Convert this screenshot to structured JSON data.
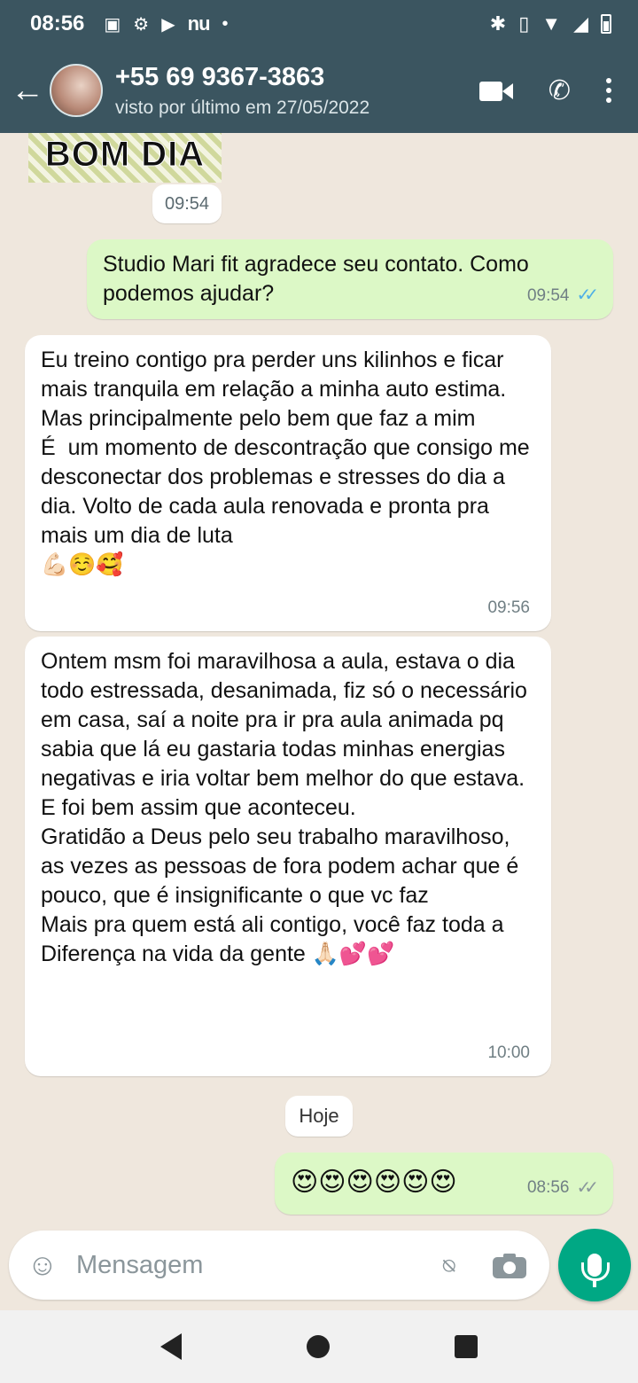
{
  "status_bar": {
    "time": "08:56",
    "icons": [
      "image-icon",
      "gear-icon",
      "youtube-icon",
      "nubank-icon",
      "dot-icon"
    ],
    "nu_label": "nu",
    "right_icons": [
      "bluetooth-icon",
      "vibrate-icon",
      "wifi-icon",
      "signal-icon",
      "battery-icon"
    ]
  },
  "header": {
    "title": "+55 69 9367-3863",
    "subtitle": "visto por último em 27/05/2022",
    "actions": [
      "video-call-icon",
      "phone-icon",
      "more-vert-icon"
    ]
  },
  "messages": {
    "sticker": {
      "text": "BOM DIA",
      "time": "09:54"
    },
    "m1": {
      "text": "Studio Mari fit agradece seu contato. Como podemos ajudar?",
      "time": "09:54",
      "status": "read"
    },
    "m2": {
      "text": "Eu treino contigo pra perder uns kilinhos e ficar mais tranquila em relação a minha auto estima.\nMas principalmente pelo bem que faz a mim\nÉ  um momento de descontração que consigo me desconectar dos problemas e stresses do dia a dia. Volto de cada aula renovada e pronta pra mais um dia de luta\n💪🏻☺️🥰",
      "time": "09:56"
    },
    "m3": {
      "text": "Ontem msm foi maravilhosa a aula, estava o dia todo estressada, desanimada, fiz só o necessário em casa, saí a noite pra ir pra aula animada pq sabia que lá eu gastaria todas minhas energias negativas e iria voltar bem melhor do que estava.\nE foi bem assim que aconteceu.\nGratidão a Deus pelo seu trabalho maravilhoso,  as vezes as pessoas de fora podem achar que é  pouco, que é insignificante o que vc faz\nMais pra quem está ali contigo, você faz toda a Diferença na vida da gente 🙏🏻💕💕",
      "time": "10:00"
    },
    "date_chip": "Hoje",
    "m4": {
      "text": "😍😍😍😍😍😍",
      "time": "08:56",
      "status": "delivered"
    }
  },
  "composer": {
    "placeholder": "Mensagem",
    "icons": [
      "emoji-icon",
      "attach-icon",
      "camera-icon",
      "mic-icon"
    ]
  },
  "colors": {
    "header_bg": "#3b5560",
    "chat_bg": "#efe7dd",
    "incoming_bubble": "#ffffff",
    "outgoing_bubble": "#dcf8c6",
    "accent_green": "#00a884",
    "read_ticks": "#4fb0e6"
  }
}
